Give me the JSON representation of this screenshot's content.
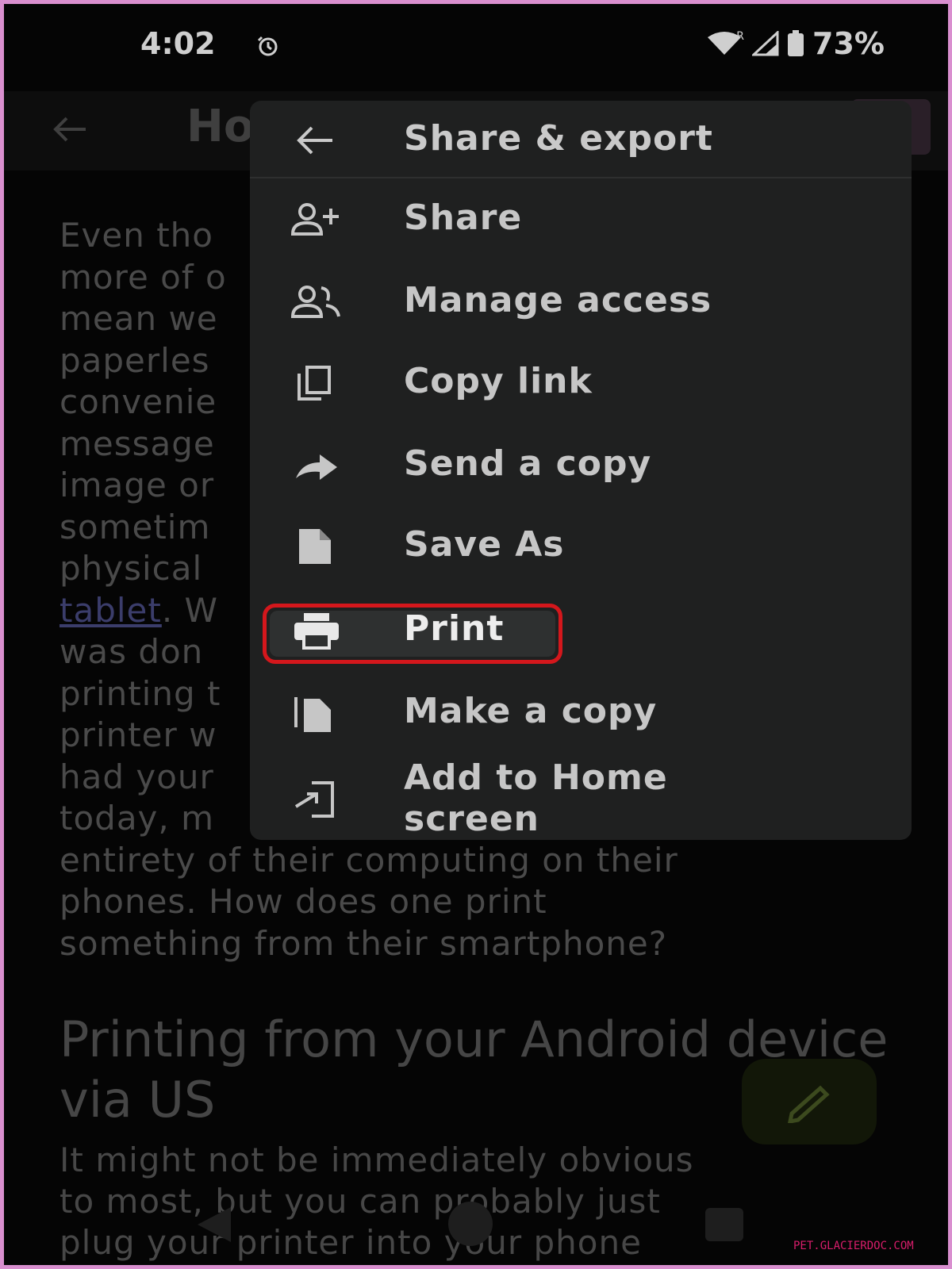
{
  "status_bar": {
    "time": "4:02",
    "network_label": "R",
    "battery": "73%"
  },
  "app_bar": {
    "title_partial": "Ho"
  },
  "document": {
    "paragraph1_lines": [
      "Even tho",
      "more of o",
      "mean we",
      "paperles",
      "convenie",
      "message",
      "image or",
      "sometim",
      "physical"
    ],
    "link_text": "tablet",
    "after_link": ". W",
    "paragraph1_lines_b": [
      "was don",
      "printing t",
      "printer w",
      "had your",
      "today, m",
      "entirety of their computing on their",
      "phones. How does one print",
      "something from their smartphone?"
    ],
    "heading": "Printing from your Android device via US",
    "paragraph2_lines": [
      "It might not be immediately obvious",
      "to most, but you can probably just",
      "plug your printer into your phone"
    ]
  },
  "menu": {
    "header": "Share & export",
    "items": [
      {
        "label": "Share",
        "icon": "person-add-icon"
      },
      {
        "label": "Manage access",
        "icon": "people-icon"
      },
      {
        "label": "Copy link",
        "icon": "copy-icon"
      },
      {
        "label": "Send a copy",
        "icon": "forward-arrow-icon"
      },
      {
        "label": "Save As",
        "icon": "file-icon"
      },
      {
        "label": "Print",
        "icon": "printer-icon"
      },
      {
        "label": "Make a copy",
        "icon": "duplicate-file-icon"
      },
      {
        "label": "Add to Home screen",
        "label_line1": "Add to Home",
        "label_line2": "screen",
        "icon": "add-to-home-icon"
      }
    ],
    "highlight_color": "#d4171c"
  },
  "watermark": "PET.GLACIERDOC.COM"
}
